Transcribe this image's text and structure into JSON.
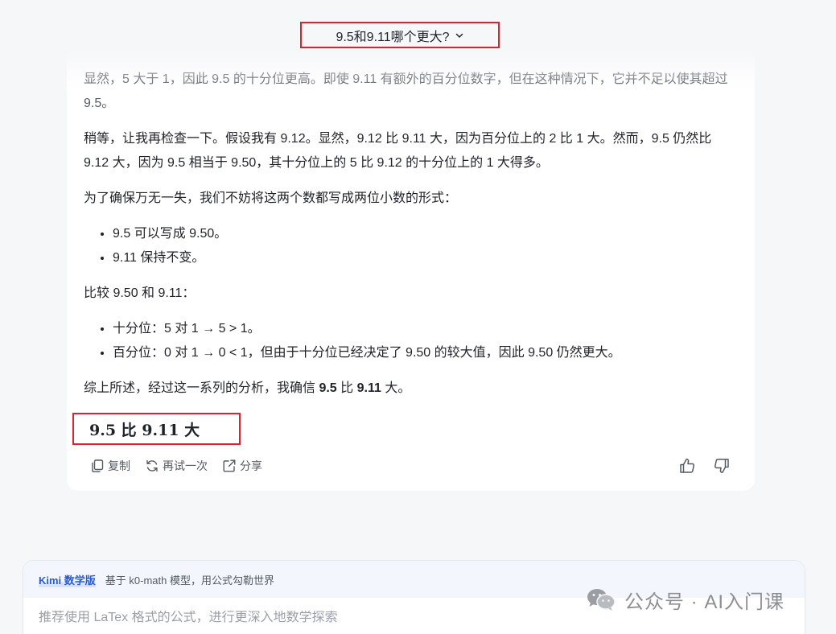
{
  "question": {
    "title": "9.5和9.11哪个更大?"
  },
  "answer": {
    "p1": "显然，5 大于 1，因此 9.5 的十分位更高。即使 9.11 有额外的百分位数字，但在这种情况下，它并不足以使其超过 9.5。",
    "p2": "稍等，让我再检查一下。假设我有 9.12。显然，9.12 比 9.11 大，因为百分位上的 2 比 1 大。然而，9.5 仍然比 9.12 大，因为 9.5 相当于 9.50，其十分位上的 5 比 9.12 的十分位上的 1 大得多。",
    "p3": "为了确保万无一失，我们不妨将这两个数都写成两位小数的形式：",
    "list1": [
      "9.5 可以写成 9.50。",
      "9.11 保持不变。"
    ],
    "p4": "比较 9.50 和 9.11：",
    "list2": [
      "十分位：5 对 1 → 5 > 1。",
      "百分位：0 对 1 → 0 < 1，但由于十分位已经决定了 9.50 的较大值，因此 9.50 仍然更大。"
    ],
    "conclusion_prefix": "综上所述，经过这一系列的分析，我确信 ",
    "conclusion_a": "9.5",
    "conclusion_mid": " 比 ",
    "conclusion_b": "9.11",
    "conclusion_suffix": " 大。",
    "final_answer": "9.5 比 9.11 大"
  },
  "actions": {
    "copy": "复制",
    "retry": "再试一次",
    "share": "分享",
    "icons": [
      "copy-icon",
      "refresh-icon",
      "share-icon",
      "thumbs-up-icon",
      "thumbs-down-icon"
    ]
  },
  "input": {
    "badge": "Kimi 数学版",
    "model_desc": "基于 k0-math 模型，用公式勾勒世界",
    "placeholder": "推荐使用 LaTex 格式的公式，进行更深入地数学探索"
  },
  "watermark": {
    "text": "公众号 · AI入门课"
  },
  "colors": {
    "highlight_border": "#e0202a",
    "accent": "#2a5bd7",
    "background": "#f6f7f9"
  }
}
